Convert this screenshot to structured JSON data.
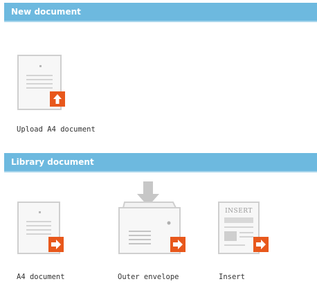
{
  "sections": {
    "new": {
      "title": "New document",
      "items": [
        {
          "label": "Upload A4 document",
          "icon": "a4-page-upload-icon"
        }
      ]
    },
    "library": {
      "title": "Library document",
      "items": [
        {
          "label": "A4 document",
          "icon": "a4-page-arrow-icon"
        },
        {
          "label": "Outer envelope",
          "icon": "envelope-arrow-icon"
        },
        {
          "label": "Insert",
          "icon": "insert-arrow-icon"
        }
      ]
    }
  },
  "colors": {
    "header": "#6db9df",
    "header_text": "#ffffff",
    "accent": "#e8581c"
  }
}
